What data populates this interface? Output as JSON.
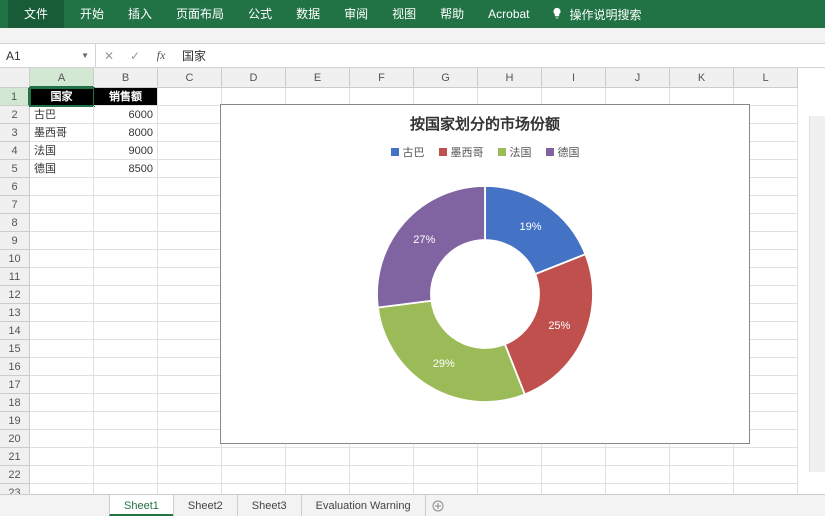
{
  "ribbon": {
    "file": "文件",
    "tabs": [
      "开始",
      "插入",
      "页面布局",
      "公式",
      "数据",
      "审阅",
      "视图",
      "帮助",
      "Acrobat"
    ],
    "search": "操作说明搜索"
  },
  "namebox": "A1",
  "formula": "国家",
  "columns": [
    "A",
    "B",
    "C",
    "D",
    "E",
    "F",
    "G",
    "H",
    "I",
    "J",
    "K",
    "L"
  ],
  "row_count": 23,
  "table": {
    "headers": [
      "国家",
      "销售额"
    ],
    "rows": [
      {
        "country": "古巴",
        "sales": "6000"
      },
      {
        "country": "墨西哥",
        "sales": "8000"
      },
      {
        "country": "法国",
        "sales": "9000"
      },
      {
        "country": "德国",
        "sales": "8500"
      }
    ]
  },
  "chart_data": {
    "type": "pie",
    "title": "按国家划分的市场份额",
    "series_name": "销售额",
    "categories": [
      "古巴",
      "墨西哥",
      "法国",
      "德国"
    ],
    "values": [
      6000,
      8000,
      9000,
      8500
    ],
    "percentages": [
      19,
      25,
      29,
      27
    ],
    "colors": [
      "#4472c4",
      "#c0504d",
      "#9bbb59",
      "#8064a2"
    ],
    "hole": 0.5,
    "legend_position": "top"
  },
  "sheets": {
    "tabs": [
      "Sheet1",
      "Sheet2",
      "Sheet3",
      "Evaluation Warning"
    ],
    "active": 0
  }
}
